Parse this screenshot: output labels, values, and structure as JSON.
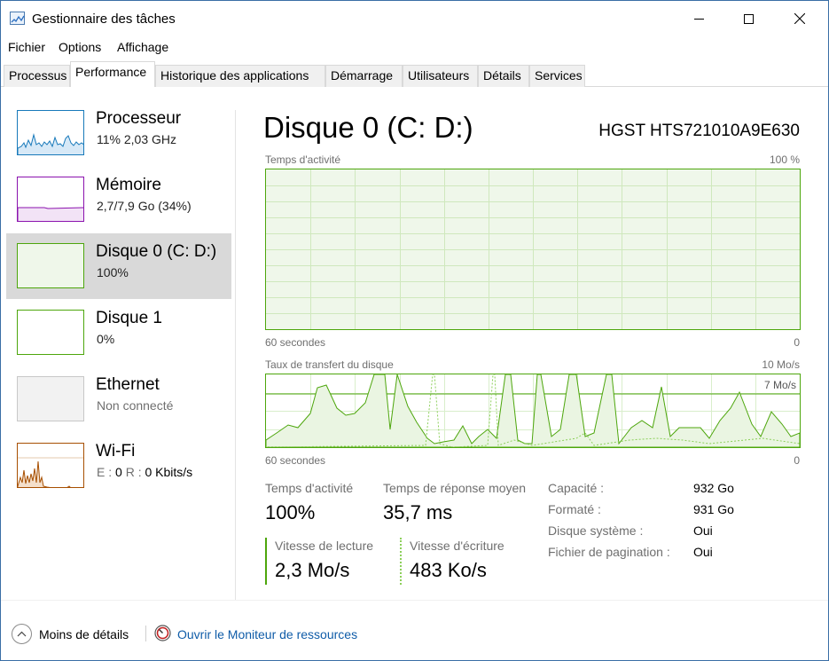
{
  "window": {
    "title": "Gestionnaire des tâches",
    "controls": {
      "minimize": "—",
      "maximize": "☐",
      "close": "✕"
    }
  },
  "menu": [
    "Fichier",
    "Options",
    "Affichage"
  ],
  "tabs": [
    "Processus",
    "Performance",
    "Historique des applications",
    "Démarrage",
    "Utilisateurs",
    "Détails",
    "Services"
  ],
  "active_tab": "Performance",
  "sidebar": {
    "items": [
      {
        "name": "Processeur",
        "sub": "11% 2,03 GHz",
        "icon": "cpu-graph-thumbnail",
        "color": "#1779ba"
      },
      {
        "name": "Mémoire",
        "sub": "2,7/7,9 Go (34%)",
        "icon": "memory-graph-thumbnail",
        "color": "#8b12ae"
      },
      {
        "name": "Disque 0 (C: D:)",
        "sub": "100%",
        "icon": "disk-graph-thumbnail",
        "color": "#4da60c"
      },
      {
        "name": "Disque 1",
        "sub": "0%",
        "icon": "disk-graph-thumbnail",
        "color": "#4da60c"
      },
      {
        "name": "Ethernet",
        "sub": "Non connecté",
        "icon": "ethernet-graph-thumbnail",
        "color": "#a0a0a0"
      },
      {
        "name": "Wi-Fi",
        "sub_e": "E :",
        "sub_e_val": "0",
        "sub_r": "R :",
        "sub_r_val": "0 Kbits/s",
        "icon": "wifi-graph-thumbnail",
        "color": "#a74f01"
      }
    ],
    "selected_index": 2
  },
  "detail": {
    "title": "Disque 0 (C: D:)",
    "model": "HGST HTS721010A9E630",
    "activity_graph": {
      "label": "Temps d'activité",
      "max": "100 %",
      "time": "60 secondes",
      "min": "0",
      "value_percent": 100
    },
    "transfer_graph": {
      "label": "Taux de transfert du disque",
      "max": "10 Mo/s",
      "line_label": "7 Mo/s",
      "time": "60 secondes",
      "min": "0"
    },
    "stats": {
      "active_time_label": "Temps d'activité",
      "active_time_value": "100%",
      "response_label": "Temps de réponse moyen",
      "response_value": "35,7 ms",
      "read_label": "Vitesse de lecture",
      "read_value": "2,3 Mo/s",
      "write_label": "Vitesse d'écriture",
      "write_value": "483 Ko/s"
    },
    "properties": [
      {
        "label": "Capacité :",
        "value": "932 Go"
      },
      {
        "label": "Formaté :",
        "value": "931 Go"
      },
      {
        "label": "Disque système :",
        "value": "Oui"
      },
      {
        "label": "Fichier de pagination :",
        "value": "Oui"
      }
    ]
  },
  "footer": {
    "less_details": "Moins de détails",
    "resource_monitor": "Ouvrir le Moniteur de ressources"
  },
  "colors": {
    "disk": "#4da60c",
    "cpu": "#1779ba",
    "memory": "#8b12ae",
    "wifi": "#a74f01",
    "link": "#0f5ca8"
  }
}
